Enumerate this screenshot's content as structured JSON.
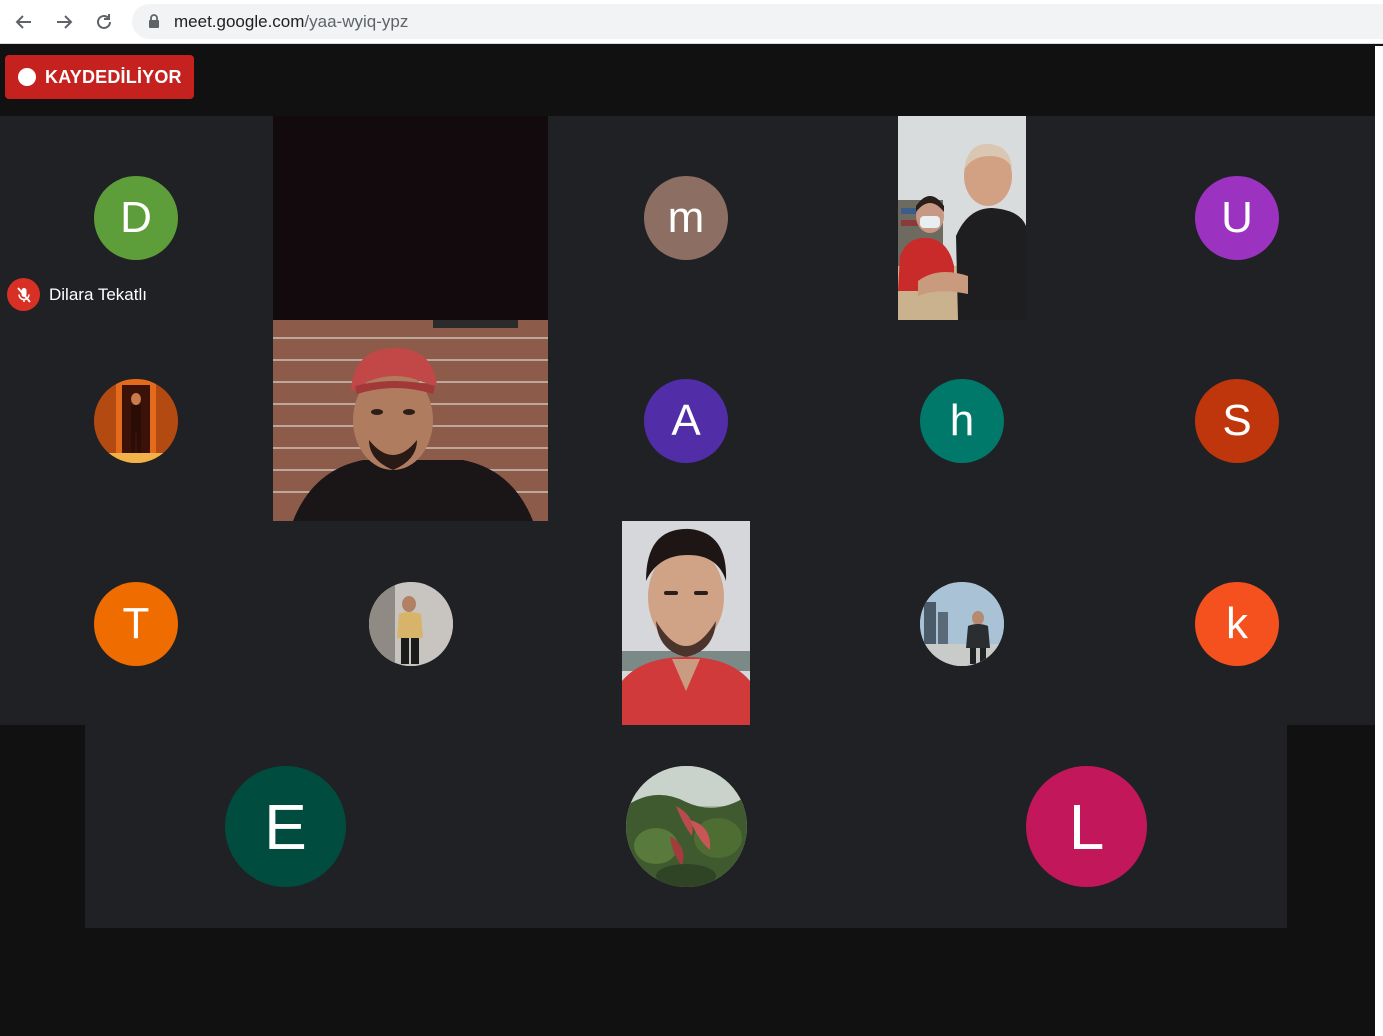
{
  "browser": {
    "url_host": "meet.google.com",
    "url_path": "/yaa-wyiq-ypz",
    "back_icon": "arrow-left-icon",
    "forward_icon": "arrow-right-icon",
    "reload_icon": "reload-icon",
    "lock_icon": "lock-icon"
  },
  "meeting": {
    "recording_label": "KAYDEDİLİYOR",
    "pinned_name": "Dilara Tekatlı",
    "pinned_muted_icon": "mic-off-icon"
  },
  "participants": [
    {
      "initial": "D",
      "color": "#5e9e3a"
    },
    {
      "initial": "m",
      "color": "#8d6e63"
    },
    {
      "initial": "U",
      "color": "#9c33c0"
    },
    {
      "initial": "A",
      "color": "#512da8"
    },
    {
      "initial": "h",
      "color": "#00796b"
    },
    {
      "initial": "S",
      "color": "#bf360c"
    },
    {
      "initial": "T",
      "color": "#ef6c00"
    },
    {
      "initial": "k",
      "color": "#f4511e"
    },
    {
      "initial": "E",
      "color": "#004d40"
    },
    {
      "initial": "L",
      "color": "#c2185b"
    }
  ],
  "colors": {
    "recording": "#c5221f",
    "tile_bg": "#202124",
    "page_bg": "#111111"
  }
}
